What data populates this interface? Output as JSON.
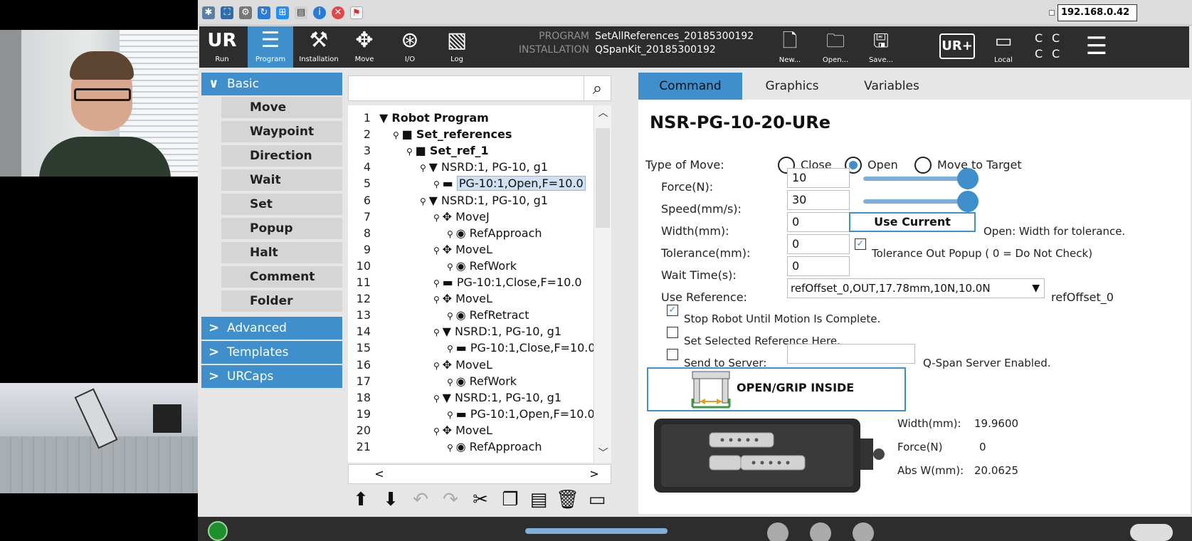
{
  "system_bar": {
    "ip_address": "192.168.0.42",
    "icons": [
      "settings-icon",
      "expand-icon",
      "gear-icon",
      "refresh-icon",
      "windows-icon",
      "document-icon",
      "info-icon",
      "close-circle-icon",
      "file-icon"
    ]
  },
  "nav": {
    "tabs": [
      {
        "label": "Run",
        "icon": "ur-logo-icon"
      },
      {
        "label": "Program",
        "icon": "program-tree-icon"
      },
      {
        "label": "Installation",
        "icon": "robot-arm-icon"
      },
      {
        "label": "Move",
        "icon": "move-arrows-icon"
      },
      {
        "label": "I/O",
        "icon": "io-icon"
      },
      {
        "label": "Log",
        "icon": "log-icon"
      }
    ],
    "active": "Program",
    "program_key": "PROGRAM",
    "program_value": "SetAllReferences_20185300192",
    "installation_key": "INSTALLATION",
    "installation_value": "QSpanKit_20185300192",
    "file_buttons": [
      {
        "label": "New...",
        "icon": "new-file-icon"
      },
      {
        "label": "Open...",
        "icon": "folder-icon"
      },
      {
        "label": "Save...",
        "icon": "save-icon"
      }
    ],
    "local_label": "Local",
    "status_glyphs": [
      "C",
      "C",
      "C",
      "C"
    ]
  },
  "sidebar": {
    "basic_label": "Basic",
    "basic_items": [
      "Move",
      "Waypoint",
      "Direction",
      "Wait",
      "Set",
      "Popup",
      "Halt",
      "Comment",
      "Folder"
    ],
    "categories": [
      "Advanced",
      "Templates",
      "URCaps"
    ]
  },
  "tree": {
    "lines": [
      {
        "n": "1",
        "text": "Robot Program",
        "indent": 0,
        "icon": "▼",
        "bold": true
      },
      {
        "n": "2",
        "text": "Set_references",
        "indent": 1,
        "icon": "■",
        "bold": true
      },
      {
        "n": "3",
        "text": "Set_ref_1",
        "indent": 2,
        "icon": "■",
        "bold": true
      },
      {
        "n": "4",
        "text": "NSRD:1, PG-10, g1",
        "indent": 3,
        "icon": "▼",
        "bold": false
      },
      {
        "n": "5",
        "text": "PG-10:1,Open,F=10.0",
        "indent": 4,
        "icon": "▬",
        "bold": false,
        "selected": true
      },
      {
        "n": "6",
        "text": "NSRD:1, PG-10, g1",
        "indent": 3,
        "icon": "▼",
        "bold": false
      },
      {
        "n": "7",
        "text": "MoveJ",
        "indent": 4,
        "icon": "✥",
        "bold": false
      },
      {
        "n": "8",
        "text": "RefApproach",
        "indent": 5,
        "icon": "◉",
        "bold": false
      },
      {
        "n": "9",
        "text": "MoveL",
        "indent": 4,
        "icon": "✥",
        "bold": false
      },
      {
        "n": "10",
        "text": "RefWork",
        "indent": 5,
        "icon": "◉",
        "bold": false
      },
      {
        "n": "11",
        "text": "PG-10:1,Close,F=10.0",
        "indent": 4,
        "icon": "▬",
        "bold": false
      },
      {
        "n": "12",
        "text": "MoveL",
        "indent": 4,
        "icon": "✥",
        "bold": false
      },
      {
        "n": "13",
        "text": "RefRetract",
        "indent": 5,
        "icon": "◉",
        "bold": false
      },
      {
        "n": "14",
        "text": "NSRD:1, PG-10, g1",
        "indent": 4,
        "icon": "▼",
        "bold": false
      },
      {
        "n": "15",
        "text": "PG-10:1,Close,F=10.0",
        "indent": 5,
        "icon": "▬",
        "bold": false
      },
      {
        "n": "16",
        "text": "MoveL",
        "indent": 4,
        "icon": "✥",
        "bold": false
      },
      {
        "n": "17",
        "text": "RefWork",
        "indent": 5,
        "icon": "◉",
        "bold": false
      },
      {
        "n": "18",
        "text": "NSRD:1, PG-10, g1",
        "indent": 4,
        "icon": "▼",
        "bold": false
      },
      {
        "n": "19",
        "text": "PG-10:1,Open,F=10.0",
        "indent": 5,
        "icon": "▬",
        "bold": false
      },
      {
        "n": "20",
        "text": "MoveL",
        "indent": 4,
        "icon": "✥",
        "bold": false
      },
      {
        "n": "21",
        "text": "RefApproach",
        "indent": 5,
        "icon": "◉",
        "bold": false
      }
    ]
  },
  "tabs": [
    "Command",
    "Graphics",
    "Variables"
  ],
  "active_tab": "Command",
  "command": {
    "title": "NSR-PG-10-20-URe",
    "type_of_move_label": "Type of Move:",
    "move_options": [
      "Close",
      "Open",
      "Move to Target"
    ],
    "move_selected": "Open",
    "force_label": "Force(N):",
    "force_value": "10",
    "force_slider_fraction": 1.0,
    "speed_label": "Speed(mm/s):",
    "speed_value": "30",
    "speed_slider_fraction": 1.0,
    "width_label": "Width(mm):",
    "width_value": "0",
    "use_current_label": "Use Current",
    "width_note": "Open: Width for tolerance.",
    "tolerance_label": "Tolerance(mm):",
    "tolerance_value": "0",
    "tolerance_popup_label": "Tolerance Out Popup ( 0 = Do Not Check)",
    "tolerance_popup_checked": true,
    "wait_label": "Wait Time(s):",
    "wait_value": "0",
    "use_reference_label": "Use Reference:",
    "reference_value": "refOffset_0,OUT,17.78mm,10N,10.0N",
    "reference_name": "refOffset_0",
    "stop_robot_label": "Stop Robot Until Motion Is Complete.",
    "stop_robot_checked": true,
    "set_selected_label": "Set Selected Reference Here.",
    "set_selected_checked": false,
    "send_server_label": "Send to Server:",
    "send_server_checked": false,
    "server_status": "Q-Span Server Enabled.",
    "grip_button_label": "OPEN/GRIP INSIDE",
    "readouts": [
      {
        "label": "Width(mm):",
        "value": "19.9600"
      },
      {
        "label": "Force(N)",
        "value": "0"
      },
      {
        "label": "Abs W(mm):",
        "value": "20.0625"
      }
    ]
  },
  "colors": {
    "accent": "#3e8fcb",
    "header": "#2d2d2d"
  }
}
